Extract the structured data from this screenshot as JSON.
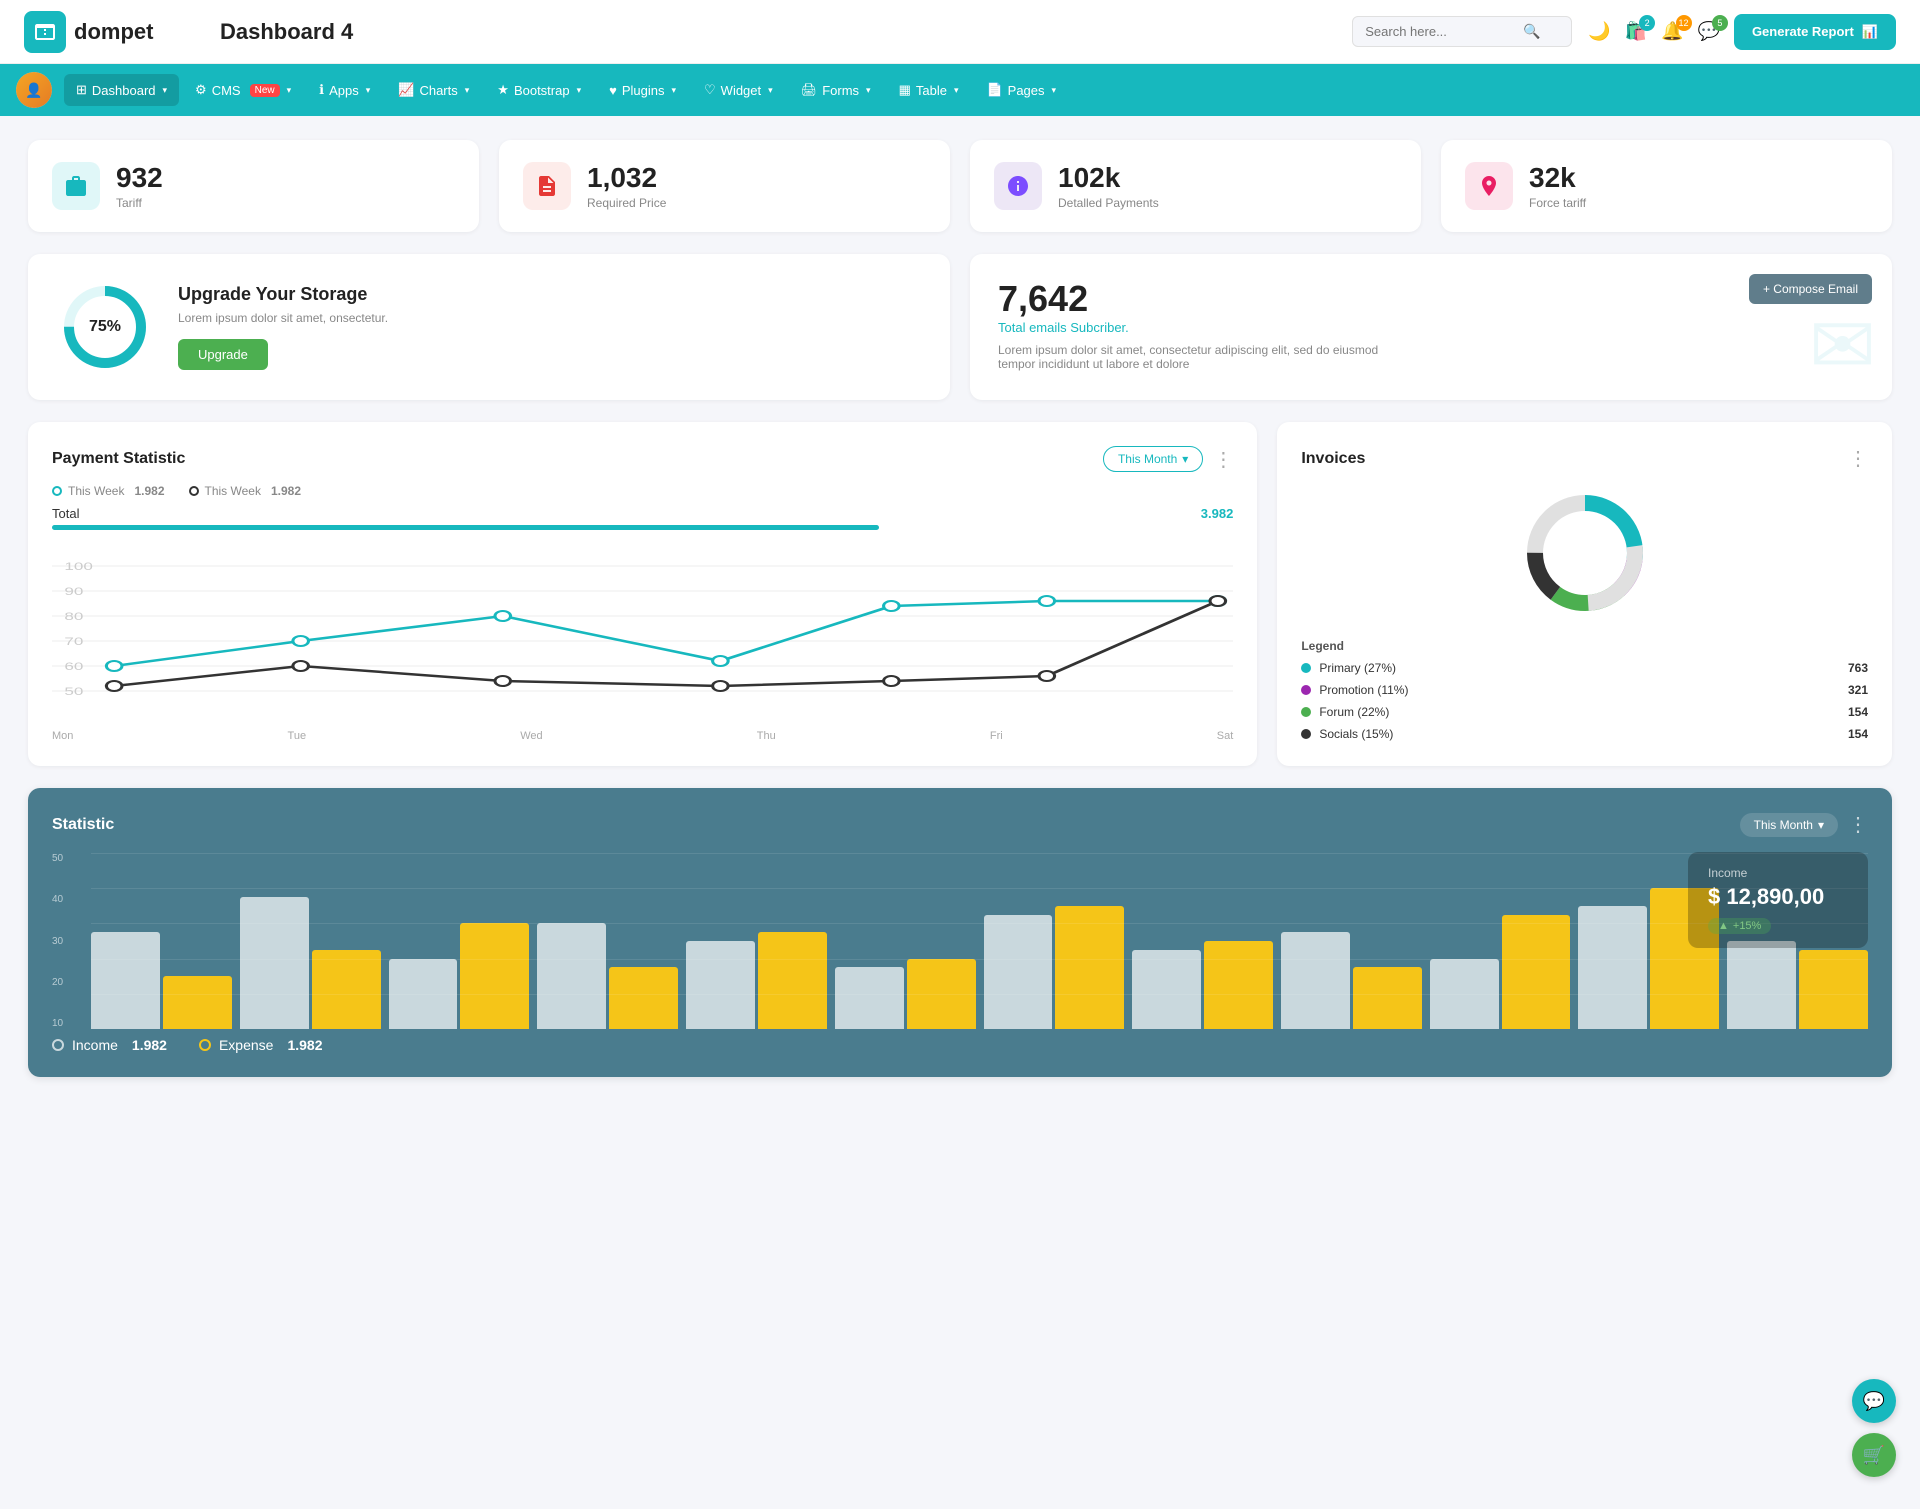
{
  "header": {
    "logo_text": "dompet",
    "page_title": "Dashboard 4",
    "search_placeholder": "Search here...",
    "generate_btn": "Generate Report",
    "icons": {
      "shop_badge": "2",
      "bell_badge": "12",
      "chat_badge": "5"
    }
  },
  "nav": {
    "items": [
      {
        "label": "Dashboard",
        "active": true,
        "has_dropdown": true
      },
      {
        "label": "CMS",
        "active": false,
        "has_badge": true,
        "badge": "New",
        "has_dropdown": true
      },
      {
        "label": "Apps",
        "active": false,
        "has_dropdown": true
      },
      {
        "label": "Charts",
        "active": false,
        "has_dropdown": true
      },
      {
        "label": "Bootstrap",
        "active": false,
        "has_dropdown": true
      },
      {
        "label": "Plugins",
        "active": false,
        "has_dropdown": true
      },
      {
        "label": "Widget",
        "active": false,
        "has_dropdown": true
      },
      {
        "label": "Forms",
        "active": false,
        "has_dropdown": true
      },
      {
        "label": "Table",
        "active": false,
        "has_dropdown": true
      },
      {
        "label": "Pages",
        "active": false,
        "has_dropdown": true
      }
    ]
  },
  "stats": [
    {
      "value": "932",
      "label": "Tariff",
      "icon_type": "teal"
    },
    {
      "value": "1,032",
      "label": "Required Price",
      "icon_type": "red"
    },
    {
      "value": "102k",
      "label": "Detalled Payments",
      "icon_type": "purple"
    },
    {
      "value": "32k",
      "label": "Force tariff",
      "icon_type": "pink"
    }
  ],
  "storage": {
    "percent": "75%",
    "title": "Upgrade Your Storage",
    "description": "Lorem ipsum dolor sit amet, onsectetur.",
    "btn_label": "Upgrade"
  },
  "email": {
    "number": "7,642",
    "subtitle": "Total emails Subcriber.",
    "description": "Lorem ipsum dolor sit amet, consectetur adipiscing elit, sed do eiusmod tempor incididunt ut labore et dolore",
    "compose_btn": "+ Compose Email"
  },
  "payment": {
    "title": "Payment Statistic",
    "filter": "This Month",
    "legend": [
      {
        "label": "This Week",
        "value": "1.982"
      },
      {
        "label": "This Week",
        "value": "1.982"
      }
    ],
    "total_label": "Total",
    "total_value": "3.982",
    "x_labels": [
      "Mon",
      "Tue",
      "Wed",
      "Thu",
      "Fri",
      "Sat"
    ]
  },
  "invoices": {
    "title": "Invoices",
    "legend": [
      {
        "label": "Primary (27%)",
        "value": "763",
        "color": "teal"
      },
      {
        "label": "Promotion (11%)",
        "value": "321",
        "color": "purple"
      },
      {
        "label": "Forum (22%)",
        "value": "154",
        "color": "green"
      },
      {
        "label": "Socials (15%)",
        "value": "154",
        "color": "dark"
      }
    ]
  },
  "statistic": {
    "title": "Statistic",
    "filter": "This Month",
    "income_label": "Income",
    "income_value": "$ 12,890,00",
    "income_badge": "+15%",
    "expense_label": "Expense",
    "legend": [
      {
        "label": "Income",
        "value": "1.982"
      },
      {
        "label": "Expense",
        "value": "1.982"
      }
    ],
    "y_labels": [
      "50",
      "40",
      "30",
      "20",
      "10"
    ],
    "bars": [
      {
        "white": 55,
        "yellow": 30
      },
      {
        "white": 75,
        "yellow": 45
      },
      {
        "white": 40,
        "yellow": 60
      },
      {
        "white": 60,
        "yellow": 35
      },
      {
        "white": 50,
        "yellow": 55
      },
      {
        "white": 35,
        "yellow": 40
      },
      {
        "white": 65,
        "yellow": 70
      },
      {
        "white": 45,
        "yellow": 50
      },
      {
        "white": 55,
        "yellow": 35
      },
      {
        "white": 40,
        "yellow": 65
      },
      {
        "white": 70,
        "yellow": 80
      },
      {
        "white": 50,
        "yellow": 45
      }
    ]
  }
}
